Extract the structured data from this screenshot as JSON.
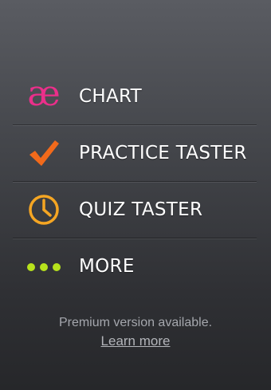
{
  "menu": {
    "items": [
      {
        "id": "chart",
        "label": "CHART",
        "icon": "ae-ligature-icon",
        "glyph": "æ",
        "color": "#ea2f8a"
      },
      {
        "id": "practice",
        "label": "PRACTICE TASTER",
        "icon": "checkmark-icon",
        "color": "#f26a1b"
      },
      {
        "id": "quiz",
        "label": "QUIZ TASTER",
        "icon": "clock-icon",
        "color": "#f5a623"
      },
      {
        "id": "more",
        "label": "MORE",
        "icon": "more-dots-icon",
        "color": "#b7e21c"
      }
    ]
  },
  "footer": {
    "text": "Premium version available.",
    "link": "Learn more"
  }
}
